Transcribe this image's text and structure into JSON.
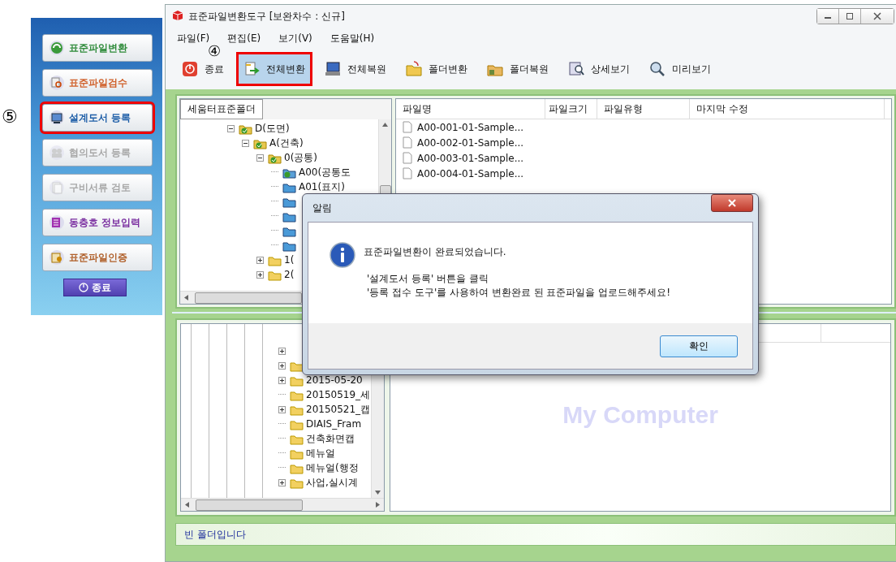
{
  "window": {
    "title": "표준파일변환도구 [보완차수 : 신규]"
  },
  "sidebar": {
    "buttons": [
      {
        "label": "표준파일변환",
        "kind": "convert",
        "color": "#2e8b3a",
        "disabled": false,
        "highlighted": false
      },
      {
        "label": "표준파일검수",
        "kind": "inspect",
        "color": "#d0602a",
        "disabled": false,
        "highlighted": false
      },
      {
        "label": "설계도서 등록",
        "kind": "register",
        "color": "#1f5fa8",
        "disabled": false,
        "highlighted": true,
        "callout": "⑤"
      },
      {
        "label": "협의도서 등록",
        "kind": "consult",
        "disabled": true,
        "highlighted": false
      },
      {
        "label": "구비서류 검토",
        "kind": "review",
        "disabled": true,
        "highlighted": false
      },
      {
        "label": "동층호 정보입력",
        "kind": "floor",
        "color": "#7a2ea0",
        "disabled": false,
        "highlighted": false
      },
      {
        "label": "표준파일인증",
        "kind": "certify",
        "color": "#b0602a",
        "disabled": false,
        "highlighted": false
      }
    ],
    "exit_button": "종료"
  },
  "menu": [
    "파일(F)",
    "편집(E)",
    "보기(V)",
    "도움말(H)"
  ],
  "toolbar": [
    {
      "label": "종료",
      "kind": "exit",
      "highlighted": false
    },
    {
      "label": "전체변환",
      "kind": "convert",
      "highlighted": true,
      "callout": "④"
    },
    {
      "label": "전체복원",
      "kind": "restore",
      "highlighted": false
    },
    {
      "label": "폴더변환",
      "kind": "folder-convert",
      "highlighted": false
    },
    {
      "label": "폴더복원",
      "kind": "folder-restore",
      "highlighted": false
    },
    {
      "label": "상세보기",
      "kind": "details",
      "highlighted": false
    },
    {
      "label": "미리보기",
      "kind": "preview",
      "highlighted": false
    }
  ],
  "folder_tree": {
    "tab": "세움터표준폴더",
    "nodes": [
      {
        "label": "D(도면)",
        "kind": "checked",
        "has_children": true,
        "expanded": true,
        "children": [
          {
            "label": "A(건축)",
            "kind": "checked",
            "has_children": true,
            "expanded": true,
            "children": [
              {
                "label": "0(공통)",
                "kind": "checked",
                "has_children": true,
                "expanded": true,
                "children": [
                  {
                    "label": "A00(공통도",
                    "kind": "shared",
                    "has_children": false
                  },
                  {
                    "label": "A01(표지)",
                    "kind": "blue",
                    "has_children": false
                  },
                  {
                    "kind": "blue",
                    "has_children": false
                  },
                  {
                    "kind": "blue",
                    "has_children": false
                  },
                  {
                    "kind": "blue",
                    "has_children": false
                  },
                  {
                    "kind": "blue",
                    "has_children": false
                  }
                ]
              },
              {
                "label": "1(",
                "kind": "yellow",
                "has_children": true,
                "expanded": false
              },
              {
                "label": "2(",
                "kind": "yellow",
                "has_children": true,
                "expanded": false
              }
            ]
          }
        ]
      }
    ]
  },
  "file_list": {
    "columns": [
      "파일명",
      "파일크기",
      "파일유형",
      "마지막 수정"
    ],
    "rows": [
      {
        "name": "A00-001-01-Sample..."
      },
      {
        "name": "A00-002-01-Sample..."
      },
      {
        "name": "A00-003-01-Sample..."
      },
      {
        "name": "A00-004-01-Sample..."
      }
    ]
  },
  "lower_tree": {
    "nodes": [
      {
        "kind": "none",
        "has_children": true,
        "expanded": false
      },
      {
        "kind": "yellow",
        "has_children": true,
        "expanded": false
      },
      {
        "label": "2015-05-20",
        "kind": "yellow",
        "has_children": true,
        "expanded": false
      },
      {
        "label": "20150519_세",
        "kind": "yellow",
        "has_children": false
      },
      {
        "label": "20150521_캡",
        "kind": "yellow",
        "has_children": true,
        "expanded": false
      },
      {
        "label": "DIAIS_Fram",
        "kind": "yellow",
        "has_children": false
      },
      {
        "label": "건축화면캡",
        "kind": "yellow",
        "has_children": false
      },
      {
        "label": "메뉴얼",
        "kind": "yellow",
        "has_children": false
      },
      {
        "label": "메뉴얼(행정",
        "kind": "yellow",
        "has_children": false
      },
      {
        "label": "사업,실시계",
        "kind": "yellow",
        "has_children": true,
        "expanded": false
      }
    ]
  },
  "computer_pane": {
    "label": "My Computer"
  },
  "dialog": {
    "title": "알림",
    "message": "표준파일변환이 완료되었습니다.",
    "instructions": [
      "'설계도서 등록' 버튼을 클릭",
      "'등록 접수 도구'를 사용하여 변환완료 된 표준파일을 업로드해주세요!"
    ],
    "ok_button": "확인"
  },
  "status_bar": {
    "text": "빈 폴더입니다"
  }
}
